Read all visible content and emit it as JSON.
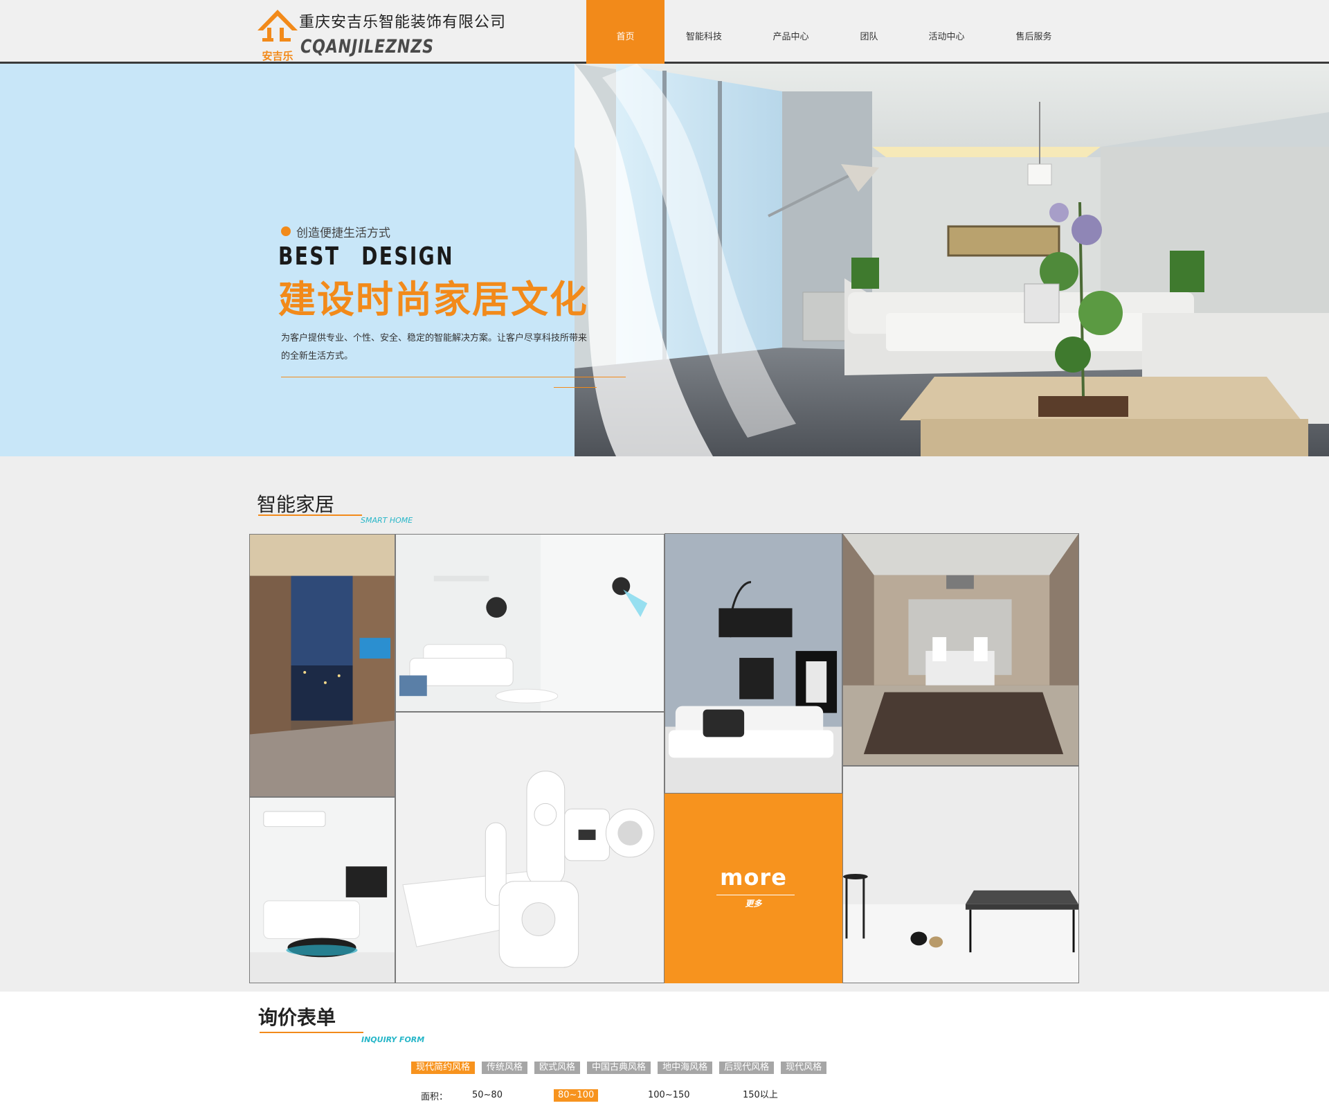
{
  "header": {
    "company_cn": "重庆安吉乐智能装饰有限公司",
    "company_en": "CQANJILEZNZS",
    "logo_text": "安吉乐",
    "nav": [
      {
        "label": "首页",
        "active": true
      },
      {
        "label": "智能科技",
        "active": false
      },
      {
        "label": "产品中心",
        "active": false
      },
      {
        "label": "团队",
        "active": false
      },
      {
        "label": "活动中心",
        "active": false
      },
      {
        "label": "售后服务",
        "active": false
      }
    ]
  },
  "banner": {
    "tagline": "创造便捷生活方式",
    "best_design": "BEST DESIGN",
    "title": "建设时尚家居文化",
    "description": "为客户提供专业、个性、安全、稳定的智能解决方案。让客户尽享科技所带来的全新生活方式。"
  },
  "smart_home": {
    "title": "智能家居",
    "subtitle": "SMART HOME",
    "more_label": "more",
    "more_sub": "更多"
  },
  "inquiry": {
    "title": "询价表单",
    "subtitle": "INQUIRY FORM",
    "styles": [
      {
        "label": "现代简约风格",
        "active": true
      },
      {
        "label": "传统风格",
        "active": false
      },
      {
        "label": "欧式风格",
        "active": false
      },
      {
        "label": "中国古典风格",
        "active": false
      },
      {
        "label": "地中海风格",
        "active": false
      },
      {
        "label": "后现代风格",
        "active": false
      },
      {
        "label": "现代风格",
        "active": false
      }
    ],
    "area_label": "面积：",
    "areas": [
      {
        "label": "50~80",
        "active": false
      },
      {
        "label": "80~100",
        "active": true
      },
      {
        "label": "100~150",
        "active": false
      },
      {
        "label": "150以上",
        "active": false
      }
    ]
  },
  "colors": {
    "accent": "#f28a1a",
    "banner_bg": "#c8e6f8",
    "section_bg": "#eeeeee",
    "teal": "#27b6c8"
  }
}
